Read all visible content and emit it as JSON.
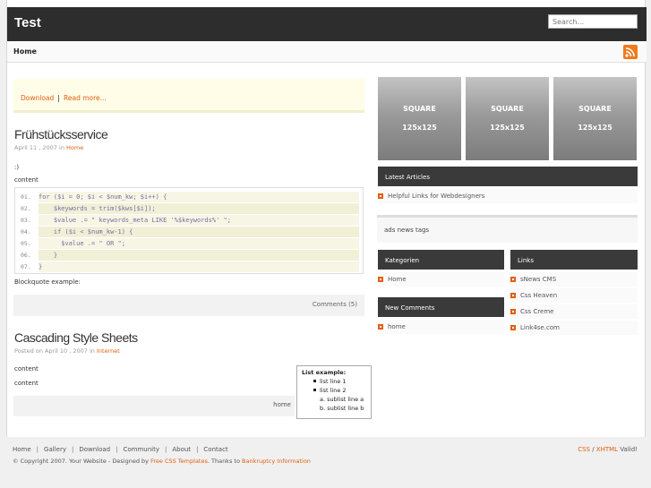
{
  "header": {
    "title": "Test",
    "search_placeholder": "Search..."
  },
  "nav": {
    "home": "Home"
  },
  "promo": {
    "download": "Download",
    "sep": "|",
    "read_more": "Read more..."
  },
  "post1": {
    "title": "Frühstücksservice",
    "date": "April 11 , 2007",
    "in": "in",
    "category": "Home",
    "smiley": ":)",
    "content": "content",
    "code": [
      {
        "n": "01.",
        "line": "for ($i = 0; $i < $num_kw; $i++) {"
      },
      {
        "n": "02.",
        "line": "    $keywords = trim($kws[$i]);"
      },
      {
        "n": "03.",
        "line": "    $value .= \" keywords_meta LIKE '%$keywords%' \";"
      },
      {
        "n": "04.",
        "line": "    if ($i < $num_kw-1) {"
      },
      {
        "n": "05.",
        "line": "      $value .= \" OR \";"
      },
      {
        "n": "06.",
        "line": "    }"
      },
      {
        "n": "07.",
        "line": "}"
      }
    ],
    "blockquote": "Blockquote example:",
    "comments": "Comments (5)"
  },
  "post2": {
    "title": "Cascading Style Sheets",
    "posted": "Posted on April 10 , 2007",
    "in": "in",
    "category": "Internet",
    "content1": "content",
    "content2": "content",
    "list_title": "List example:",
    "bullets": [
      "list line 1",
      "list line 2"
    ],
    "sub": [
      "a. sublist line a",
      "b. sublist line b"
    ],
    "home": "home"
  },
  "squares": [
    {
      "l1": "SQUARE",
      "l2": "125x125"
    },
    {
      "l1": "SQUARE",
      "l2": "125x125"
    },
    {
      "l1": "SQUARE",
      "l2": "125x125"
    }
  ],
  "sidebar": {
    "latest_title": "Latest Articles",
    "latest_items": [
      "Helpful Links for Webdesigners"
    ],
    "tags_title": "ads news tags",
    "kategorien_title": "Kategorien",
    "kategorien_items": [
      "Home"
    ],
    "new_comments_title": "New Comments",
    "new_comments_items": [
      "home"
    ],
    "links_title": "Links",
    "links_items": [
      "sNews CMS",
      "Css Heaven",
      "Css Creme",
      "Link4se.com"
    ]
  },
  "footer": {
    "links": [
      "Home",
      "Gallery",
      "Download",
      "Community",
      "About",
      "Contact"
    ],
    "sep": "|",
    "copy_a": "© Copyright 2007. Your Website - Designed by",
    "designer": "Free CSS Templates",
    "copy_b": ". Thanks to",
    "thanks": "Bankruptcy Information",
    "css": "CSS",
    "slash": "/",
    "xhtml": "XHTML",
    "valid": "Valid!"
  },
  "colors": {
    "accent": "#e35d10",
    "header_bg": "#2d2d2d",
    "sidebar_head": "#3a3a3a"
  }
}
